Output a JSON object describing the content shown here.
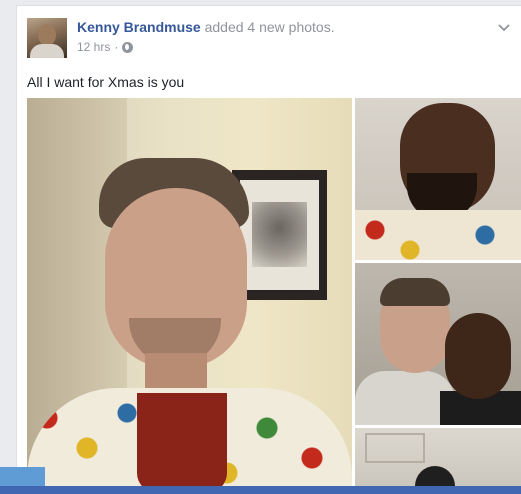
{
  "post": {
    "author": "Kenny Brandmuse",
    "action": " added 4 new photos.",
    "time": "12 hrs",
    "separator": "·",
    "audience_icon": "globe-icon",
    "menu_icon": "chevron-down-icon",
    "text": "All I want for Xmas is you",
    "photos": [
      {
        "name": "photo-main"
      },
      {
        "name": "photo-top-right"
      },
      {
        "name": "photo-middle-right"
      },
      {
        "name": "photo-bottom-right"
      }
    ]
  },
  "colors": {
    "author_link": "#365899",
    "meta_text": "#90949c",
    "body_text": "#1d2129",
    "page_bg": "#e9ebee",
    "bottom_bar": "#4267b2"
  }
}
